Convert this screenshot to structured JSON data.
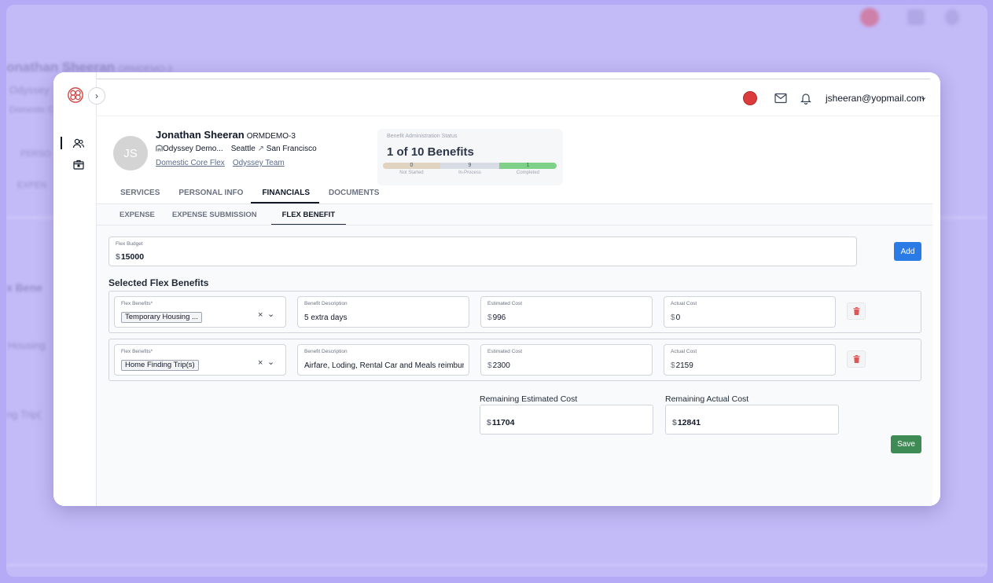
{
  "background": {
    "ghost_texts": [
      "onathan Sheeran",
      "ORMDEMO-3",
      "Odyssey",
      "Domestic C",
      "PERSO",
      "EXPEN",
      "x Bene",
      "Housing",
      "ng Trip("
    ]
  },
  "header": {
    "user_email": "jsheeran@yopmail.com",
    "icons": [
      "record-dot-icon",
      "mail-icon",
      "bell-icon",
      "chevron-down-icon"
    ]
  },
  "sidebar": {
    "items": [
      {
        "icon": "users-icon",
        "active": true
      },
      {
        "icon": "package-icon",
        "active": false
      }
    ]
  },
  "profile": {
    "initials": "JS",
    "name": "Jonathan Sheeran",
    "code": "ORMDEMO-3",
    "company": "Odyssey Demo...",
    "from_city": "Seattle",
    "to_city": "San Francisco",
    "arrow": "↗",
    "links": [
      "Domestic Core Flex",
      "Odyssey Team"
    ]
  },
  "status": {
    "label": "Benefit Administration Status",
    "title": "1 of 10 Benefits",
    "segments": [
      {
        "label": "Not Started",
        "count": "0",
        "color": "#e0d4c0",
        "fraction": 0.33
      },
      {
        "label": "In-Process",
        "count": "9",
        "color": "#d8dce4",
        "fraction": 0.34
      },
      {
        "label": "Completed",
        "count": "1",
        "color": "#7fd18a",
        "fraction": 0.33
      }
    ]
  },
  "tabs": [
    "SERVICES",
    "PERSONAL INFO",
    "FINANCIALS",
    "DOCUMENTS"
  ],
  "subtabs": [
    "EXPENSE",
    "EXPENSE SUBMISSION",
    "FLEX BENEFIT"
  ],
  "currency": "$",
  "budget": {
    "label": "Flex Budget",
    "value": "15000"
  },
  "add_label": "Add",
  "section_title": "Selected Flex Benefits",
  "rows": [
    {
      "benefit_label": "Flex Benefits*",
      "benefit": "Temporary Housing ...",
      "desc_label": "Benefit Description",
      "description": "5 extra days",
      "est_label": "Estimated Cost",
      "estimated": "996",
      "act_label": "Actual Cost",
      "actual": "0"
    },
    {
      "benefit_label": "Flex Benefits*",
      "benefit": "Home Finding Trip(s)",
      "desc_label": "Benefit Description",
      "description": "Airfare, Loding, Rental Car and Meals reimbursement",
      "est_label": "Estimated Cost",
      "estimated": "2300",
      "act_label": "Actual Cost",
      "actual": "2159"
    }
  ],
  "remaining": {
    "est_label": "Remaining Estimated Cost",
    "est_value": "11704",
    "act_label": "Remaining Actual Cost",
    "act_value": "12841"
  },
  "save_label": "Save",
  "select_clear": "×",
  "select_chevron": "⌄"
}
